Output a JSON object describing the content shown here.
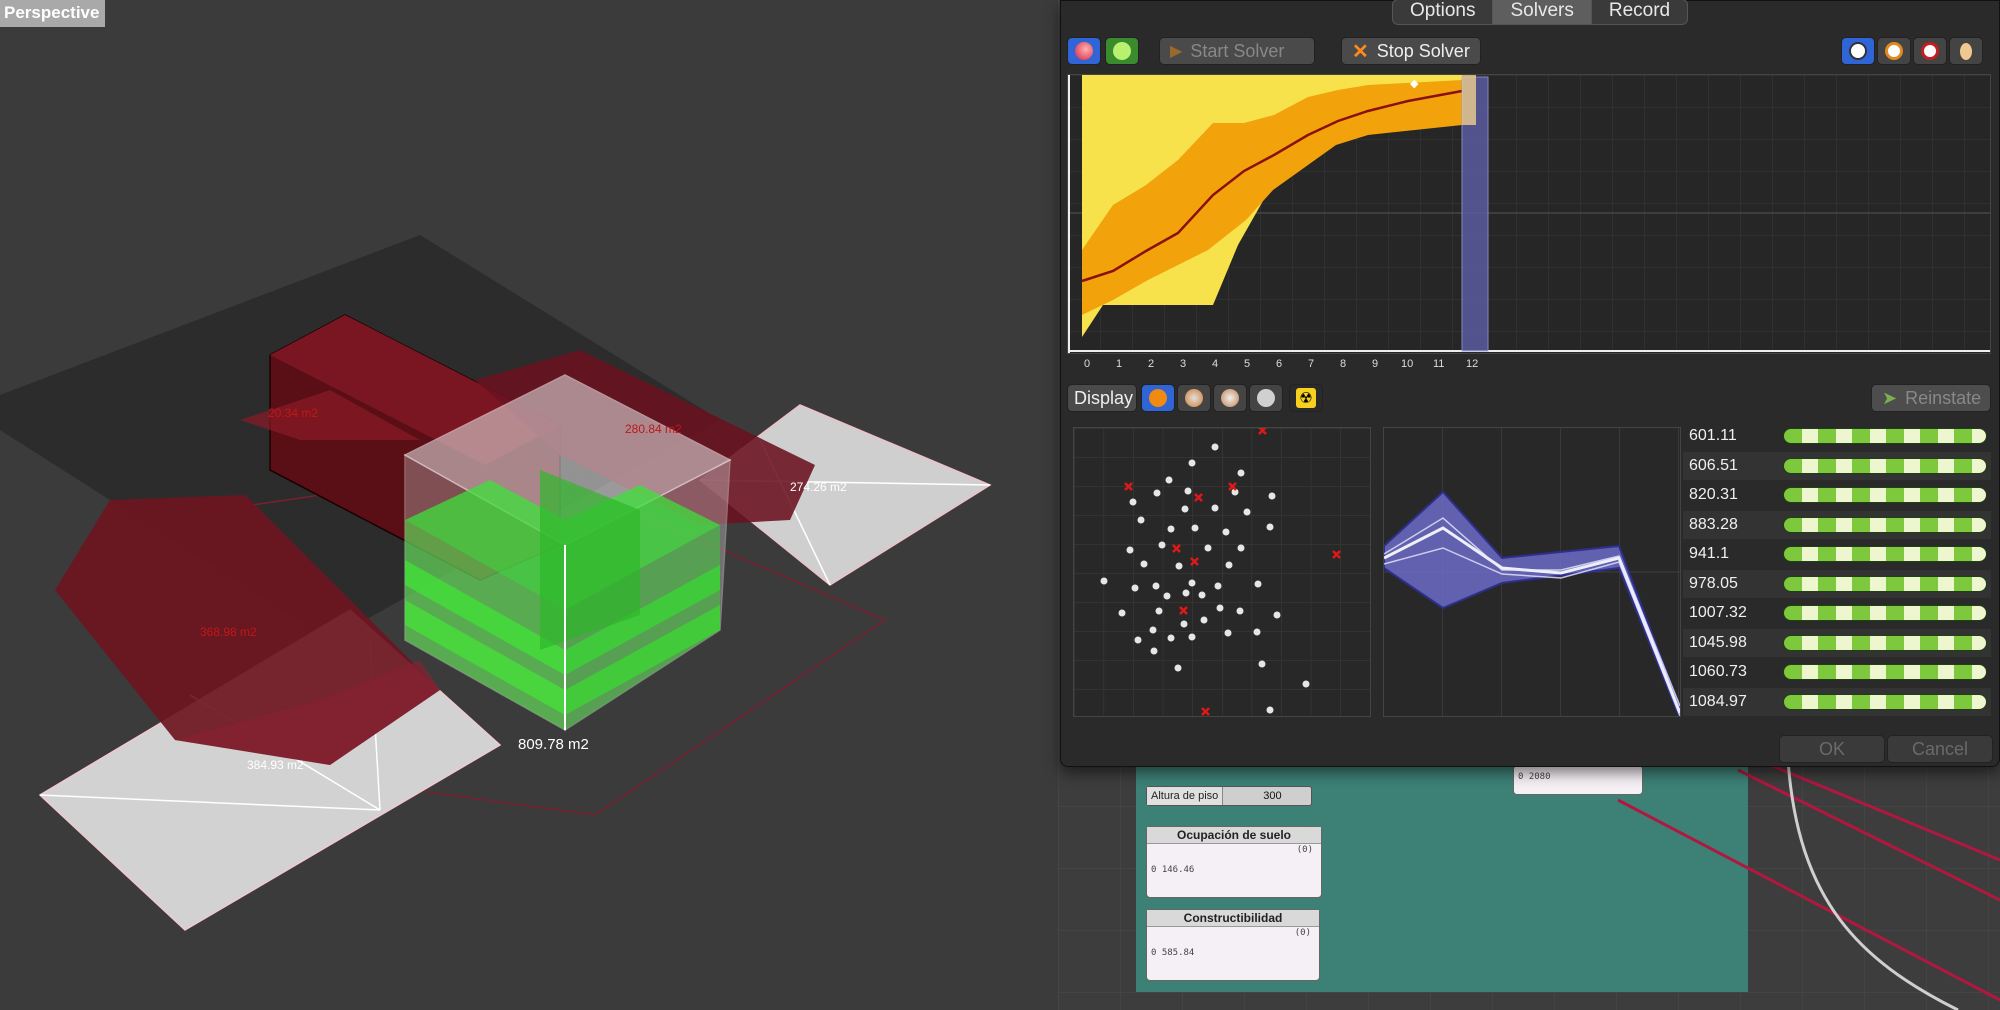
{
  "viewport": {
    "label": "Perspective",
    "dimensions": {
      "main": "809.78 m2",
      "right": "274.26 m2",
      "bottom_left": "384.93 m2",
      "red_a": "20.34 m2",
      "red_b": "280.84 m2",
      "red_c": "368.98 m2"
    }
  },
  "solver": {
    "tabs": [
      "Options",
      "Solvers",
      "Record"
    ],
    "active_tab": "Solvers",
    "start_label": "Start Solver",
    "stop_label": "Stop Solver",
    "display_label": "Display",
    "reinstate_label": "Reinstate",
    "ok_label": "OK",
    "cancel_label": "Cancel",
    "x_ticks": [
      "0",
      "1",
      "2",
      "3",
      "4",
      "5",
      "6",
      "7",
      "8",
      "9",
      "10",
      "11",
      "12"
    ],
    "values": [
      "601.11",
      "606.51",
      "820.31",
      "883.28",
      "941.1",
      "978.05",
      "1007.32",
      "1045.98",
      "1060.73",
      "1084.97"
    ]
  },
  "canvas": {
    "slider_label": "Altura de piso",
    "slider_value": "300",
    "node1_title": "Ocupación de suelo",
    "node1_index": "(0)",
    "node1_value": "0 146.46",
    "node2_title": "Constructibilidad",
    "node2_index": "(0)",
    "node2_value": "0 585.84",
    "small_node_value": "0 2080"
  },
  "colors": {
    "accent_blue": "#2f65d6",
    "fitness_yellow": "#f7e04a",
    "fitness_orange": "#f2a20b",
    "red_volume": "#6a1018",
    "green_volume": "#46d83a"
  }
}
